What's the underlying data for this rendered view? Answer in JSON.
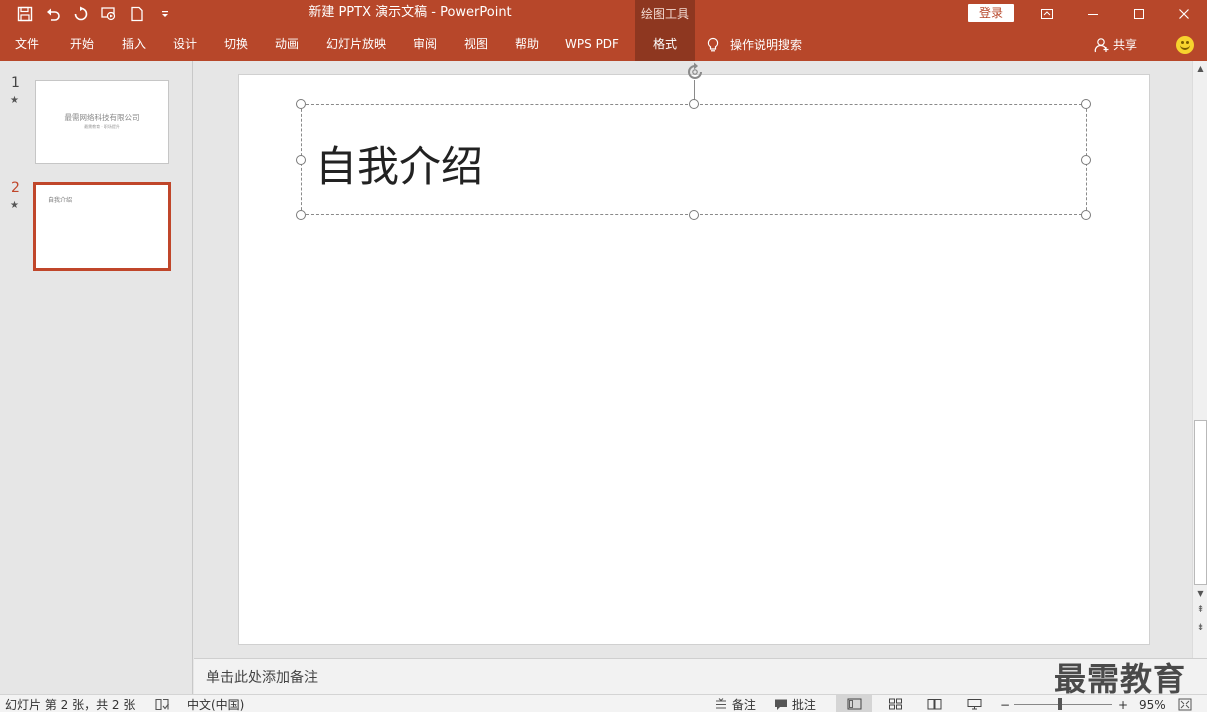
{
  "titlebar": {
    "title": "新建 PPTX 演示文稿  -  PowerPoint",
    "context_tab_group": "绘图工具",
    "login": "登录",
    "qat_icons": [
      "save-icon",
      "undo-icon",
      "redo-icon",
      "present-from-start-icon",
      "new-document-icon",
      "customize-qat-icon"
    ],
    "window_icons": [
      "ribbon-display-options-icon",
      "minimize-icon",
      "maximize-icon",
      "close-icon"
    ]
  },
  "ribbon": {
    "tabs": [
      "文件",
      "开始",
      "插入",
      "设计",
      "切换",
      "动画",
      "幻灯片放映",
      "审阅",
      "视图",
      "帮助",
      "WPS PDF",
      "格式"
    ],
    "active_tab": "格式",
    "tell_me": "操作说明搜索",
    "share": "共享"
  },
  "thumbnails": [
    {
      "number": "1",
      "title": "最需网络科技有限公司",
      "subtitle": "最需教育 · 职场提升"
    },
    {
      "number": "2",
      "title": "自我介绍"
    }
  ],
  "selected_slide": 2,
  "slide": {
    "title_text": "自我介绍"
  },
  "notes": {
    "placeholder": "单击此处添加备注"
  },
  "watermark": "最需教育",
  "statusbar": {
    "slide_info": "幻灯片 第 2 张，共 2 张",
    "language": "中文(中国)",
    "notes_label": "备注",
    "comments_label": "批注",
    "zoom_minus": "−",
    "zoom_plus": "+",
    "zoom": "95%",
    "zoom_fraction": 0.47
  },
  "colors": {
    "accent": "#b7472a",
    "accent_dark": "#8e3720",
    "selection": "#c0462a"
  }
}
